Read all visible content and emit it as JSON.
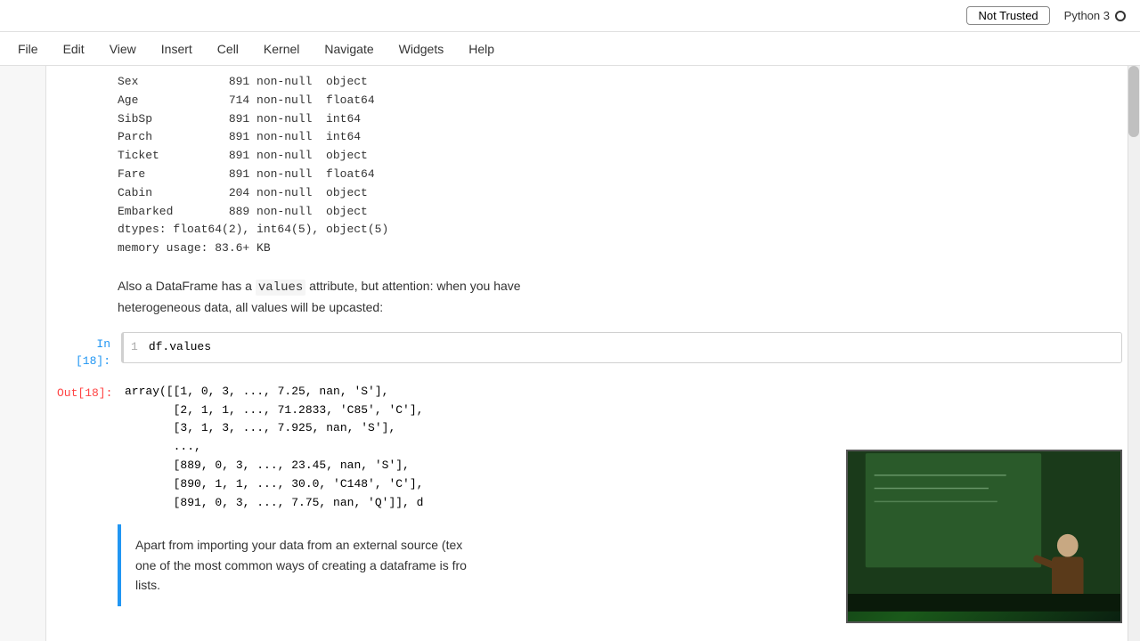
{
  "topbar": {
    "not_trusted_label": "Not Trusted",
    "python_label": "Python 3"
  },
  "menu": {
    "items": [
      "File",
      "Edit",
      "View",
      "Insert",
      "Cell",
      "Kernel",
      "Navigate",
      "Widgets",
      "Help"
    ]
  },
  "notebook": {
    "output_top": {
      "lines": [
        "Sex             891 non-null  object",
        "Age             714 non-null  float64",
        "SibSp           891 non-null  int64",
        "Parch           891 non-null  int64",
        "Ticket          891 non-null  object",
        "Fare            891 non-null  float64",
        "Cabin           204 non-null  object",
        "Embarked        889 non-null  object",
        "dtypes: float64(2), int64(5), object(5)",
        "memory usage: 83.6+ KB"
      ]
    },
    "text_block1": {
      "text": "Also a DataFrame has a ",
      "code": "values",
      "text2": " attribute, but attention: when you have",
      "line2": "heterogeneous data, all values will be upcasted:"
    },
    "cell18": {
      "label_in": "In [18]:",
      "line_num": "1",
      "code": "df.values",
      "label_out": "Out[18]:",
      "output_lines": [
        "array([[1, 0, 3, ..., 7.25, nan, 'S'],",
        "       [2, 1, 1, ..., 71.2833, 'C85', 'C'],",
        "       [3, 1, 3, ..., 7.925, nan, 'S'],",
        "       ...,",
        "       [889, 0, 3, ..., 23.45, nan, 'S'],",
        "       [890, 1, 1, ..., 30.0, 'C148', 'C'],",
        "       [891, 0, 3, ..., 7.75, nan, 'Q']], d"
      ]
    },
    "text_block2": {
      "text": "Apart from importing your data from an external source (tex",
      "line2": "one of the most common ways of creating a dataframe is fro",
      "line3": "lists."
    }
  }
}
